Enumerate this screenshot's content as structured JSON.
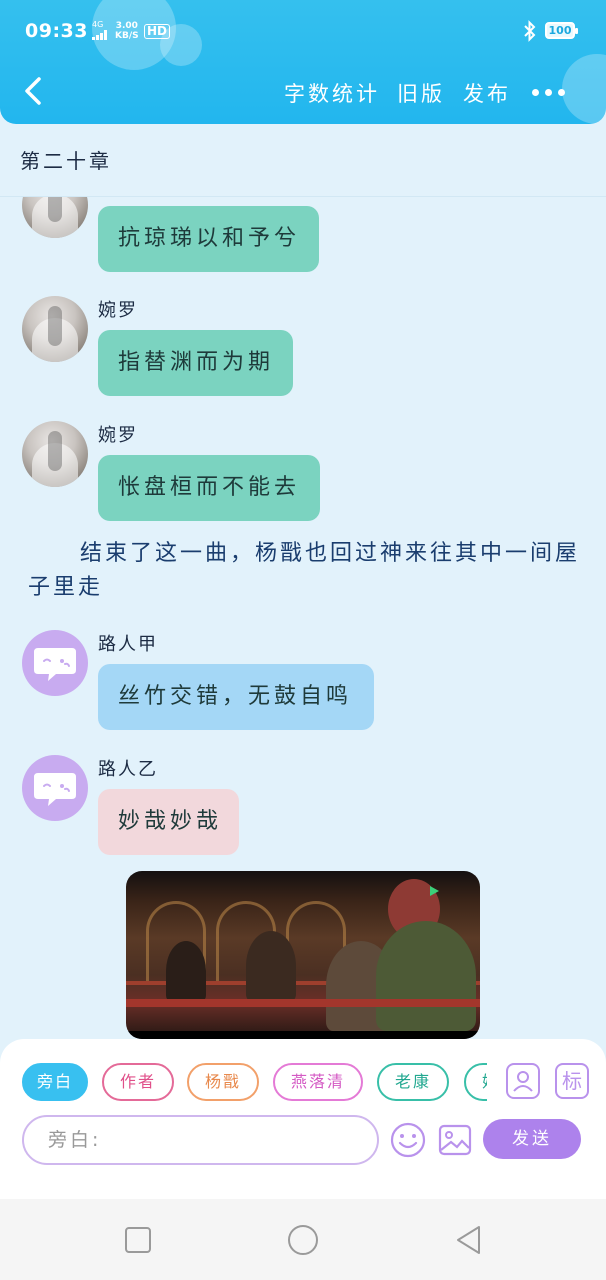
{
  "status_bar": {
    "time": "09:33",
    "network": "4G",
    "speed_value": "3.00",
    "speed_unit": "KB/S",
    "hd": "HD",
    "battery": "100"
  },
  "header": {
    "word_count": "字数统计",
    "old_version": "旧版",
    "publish": "发布"
  },
  "chapter": "第二十章",
  "messages": [
    {
      "name": "",
      "text": "抗琼珶以和予兮"
    },
    {
      "name": "婉罗",
      "text": "指替渊而为期"
    },
    {
      "name": "婉罗",
      "text": "怅盘桓而不能去"
    }
  ],
  "narration": "结束了这一曲，杨戬也回过神来往其中一间屋子里走",
  "messages2": [
    {
      "name": "路人甲",
      "text": "丝竹交错，无鼓自鸣"
    },
    {
      "name": "路人乙",
      "text": "妙哉妙哉"
    }
  ],
  "roles": [
    "旁白",
    "作者",
    "杨戬",
    "燕落清",
    "老康",
    "妙"
  ],
  "role_side": {
    "profile": "",
    "mark": "标"
  },
  "input": {
    "placeholder": "旁白:"
  },
  "send": "发送",
  "colors": {
    "header": "#22b6ee",
    "teal_bubble": "#7bd3c0",
    "blue_bubble": "#a4d7f6",
    "pink_bubble": "#f2d8dc",
    "send": "#ad82ec"
  }
}
